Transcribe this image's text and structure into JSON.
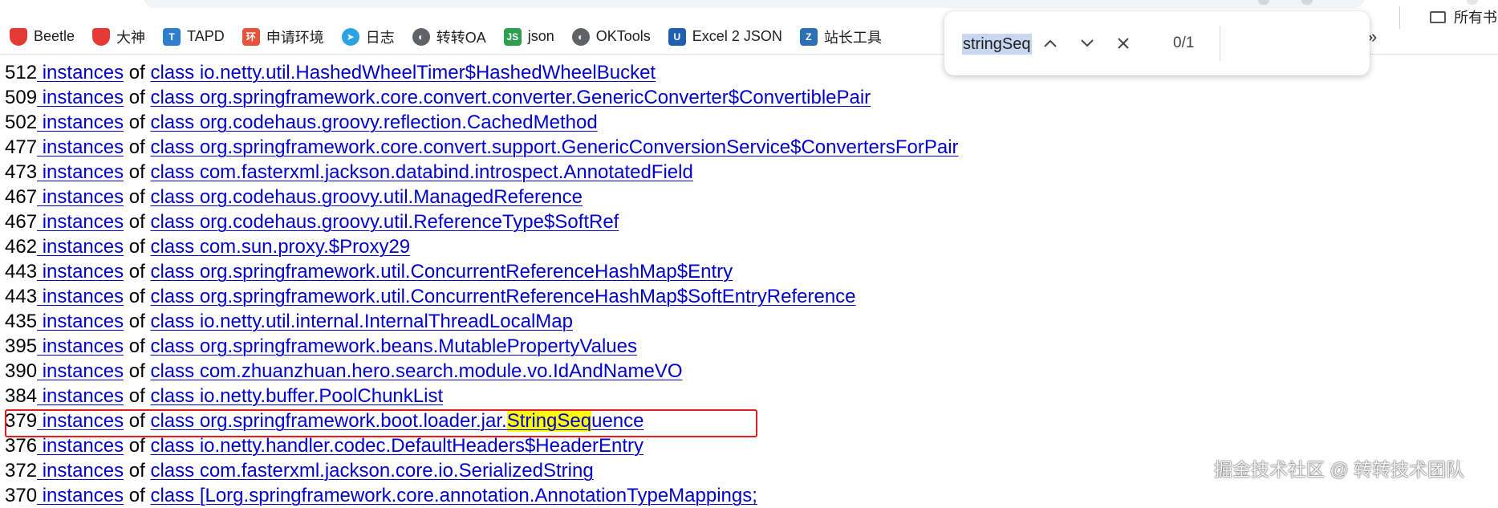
{
  "bookmarks": [
    {
      "label": "Beetle",
      "icon": "beetle-shield-icon",
      "color": "#e53935"
    },
    {
      "label": "大神",
      "icon": "dashen-shield-icon",
      "color": "#e53935"
    },
    {
      "label": "TAPD",
      "icon": "tapd-icon",
      "color": "#2f7dd1"
    },
    {
      "label": "申请环境",
      "icon": "env-icon",
      "color": "#e5533a"
    },
    {
      "label": "日志",
      "icon": "telegram-icon",
      "color": "#2aa3e0"
    },
    {
      "label": "转转OA",
      "icon": "globe-icon",
      "color": "#5f6368"
    },
    {
      "label": "json",
      "icon": "json-icon",
      "color": "#2e9e4f"
    },
    {
      "label": "OKTools",
      "icon": "globe-icon",
      "color": "#5f6368"
    },
    {
      "label": "Excel 2 JSON",
      "icon": "u-icon",
      "color": "#1f5fb0"
    },
    {
      "label": "站长工具",
      "icon": "chinaz-icon",
      "color": "#2c6fb5"
    }
  ],
  "bookmarks_more": "»",
  "bookmarks_folder": "所有书",
  "find": {
    "query": "stringSeq",
    "count": "0/1"
  },
  "rows": [
    {
      "count": "512",
      "instances": " instances",
      "of": " of ",
      "cls": "class io.netty.util.HashedWheelTimer$HashedWheelBucket"
    },
    {
      "count": "509",
      "instances": " instances",
      "of": " of ",
      "cls": "class org.springframework.core.convert.converter.GenericConverter$ConvertiblePair"
    },
    {
      "count": "502",
      "instances": " instances",
      "of": " of ",
      "cls": "class org.codehaus.groovy.reflection.CachedMethod"
    },
    {
      "count": "477",
      "instances": " instances",
      "of": " of ",
      "cls": "class org.springframework.core.convert.support.GenericConversionService$ConvertersForPair"
    },
    {
      "count": "473",
      "instances": " instances",
      "of": " of ",
      "cls": "class com.fasterxml.jackson.databind.introspect.AnnotatedField"
    },
    {
      "count": "467",
      "instances": " instances",
      "of": " of ",
      "cls": "class org.codehaus.groovy.util.ManagedReference"
    },
    {
      "count": "467",
      "instances": " instances",
      "of": " of ",
      "cls": "class org.codehaus.groovy.util.ReferenceType$SoftRef"
    },
    {
      "count": "462",
      "instances": " instances",
      "of": " of ",
      "cls": "class com.sun.proxy.$Proxy29"
    },
    {
      "count": "443",
      "instances": " instances",
      "of": " of ",
      "cls": "class org.springframework.util.ConcurrentReferenceHashMap$Entry"
    },
    {
      "count": "443",
      "instances": " instances",
      "of": " of ",
      "cls": "class org.springframework.util.ConcurrentReferenceHashMap$SoftEntryReference"
    },
    {
      "count": "435",
      "instances": " instances",
      "of": " of ",
      "cls": "class io.netty.util.internal.InternalThreadLocalMap"
    },
    {
      "count": "395",
      "instances": " instances",
      "of": " of ",
      "cls": "class org.springframework.beans.MutablePropertyValues"
    },
    {
      "count": "390",
      "instances": " instances",
      "of": " of ",
      "cls": "class com.zhuanzhuan.hero.search.module.vo.IdAndNameVO"
    },
    {
      "count": "384",
      "instances": " instances",
      "of": " of ",
      "cls": "class io.netty.buffer.PoolChunkList"
    },
    {
      "count": "379",
      "instances": " instances",
      "of": " of ",
      "cls_pre": "class org.springframework.boot.loader.jar.",
      "cls_hl": "StringSeq",
      "cls_post": "uence"
    },
    {
      "count": "376",
      "instances": " instances",
      "of": " of ",
      "cls": "class io.netty.handler.codec.DefaultHeaders$HeaderEntry"
    },
    {
      "count": "372",
      "instances": " instances",
      "of": " of ",
      "cls": "class com.fasterxml.jackson.core.io.SerializedString"
    },
    {
      "count": "370",
      "instances": " instances",
      "of": " of ",
      "cls": "class [Lorg.springframework.core.annotation.AnnotationTypeMappings;"
    }
  ],
  "watermark": "掘金技术社区 @ 转转技术团队"
}
